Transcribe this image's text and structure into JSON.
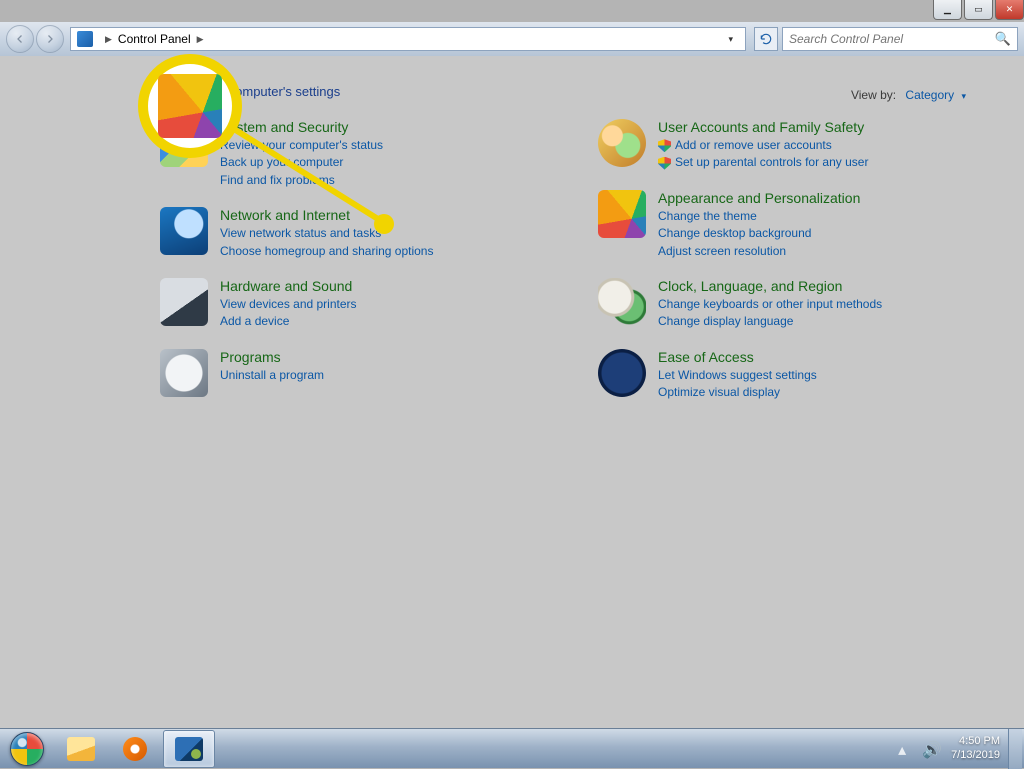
{
  "breadcrumb": {
    "root": "Control Panel"
  },
  "search": {
    "placeholder": "Search Control Panel"
  },
  "page": {
    "title": "Adjust your computer's settings"
  },
  "viewby": {
    "label": "View by:",
    "value": "Category"
  },
  "left_column": [
    {
      "title": "System and Security",
      "icon": "system",
      "links": [
        {
          "label": "Review your computer's status"
        },
        {
          "label": "Back up your computer"
        },
        {
          "label": "Find and fix problems"
        }
      ]
    },
    {
      "title": "Network and Internet",
      "icon": "network",
      "links": [
        {
          "label": "View network status and tasks"
        },
        {
          "label": "Choose homegroup and sharing options"
        }
      ]
    },
    {
      "title": "Hardware and Sound",
      "icon": "hardware",
      "links": [
        {
          "label": "View devices and printers"
        },
        {
          "label": "Add a device"
        }
      ]
    },
    {
      "title": "Programs",
      "icon": "programs",
      "links": [
        {
          "label": "Uninstall a program"
        }
      ]
    }
  ],
  "right_column": [
    {
      "title": "User Accounts and Family Safety",
      "icon": "users",
      "links": [
        {
          "label": "Add or remove user accounts",
          "shield": true
        },
        {
          "label": "Set up parental controls for any user",
          "shield": true
        }
      ]
    },
    {
      "title": "Appearance and Personalization",
      "icon": "appearance",
      "links": [
        {
          "label": "Change the theme"
        },
        {
          "label": "Change desktop background"
        },
        {
          "label": "Adjust screen resolution"
        }
      ]
    },
    {
      "title": "Clock, Language, and Region",
      "icon": "clock",
      "links": [
        {
          "label": "Change keyboards or other input methods"
        },
        {
          "label": "Change display language"
        }
      ]
    },
    {
      "title": "Ease of Access",
      "icon": "ease",
      "links": [
        {
          "label": "Let Windows suggest settings"
        },
        {
          "label": "Optimize visual display"
        }
      ]
    }
  ],
  "tray": {
    "time": "4:50 PM",
    "date": "7/13/2019"
  }
}
